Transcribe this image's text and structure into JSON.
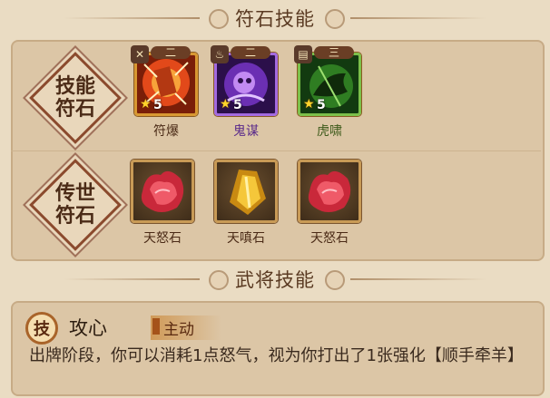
{
  "headers": {
    "rune_skills": "符石技能",
    "general_skills": "武将技能"
  },
  "rows": {
    "skill_runes_label": "技能符石",
    "legend_runes_label": "传世符石"
  },
  "skill_runes": [
    {
      "name": "符爆",
      "rank": "二",
      "level": "5",
      "icon": "crossed-swords-icon",
      "theme": "orange"
    },
    {
      "name": "鬼谋",
      "rank": "二",
      "level": "5",
      "icon": "flame-icon",
      "theme": "purple"
    },
    {
      "name": "虎啸",
      "rank": "三",
      "level": "5",
      "icon": "scroll-icon",
      "theme": "green"
    }
  ],
  "legend_runes": [
    {
      "name": "天怒石",
      "color": "red"
    },
    {
      "name": "天嗔石",
      "color": "gold"
    },
    {
      "name": "天怒石",
      "color": "red"
    }
  ],
  "general_skill": {
    "badge": "技",
    "name": "攻心",
    "type": "主动",
    "description": "出牌阶段，你可以消耗1点怒气，视为你打出了1张强化【顺手牵羊】"
  }
}
